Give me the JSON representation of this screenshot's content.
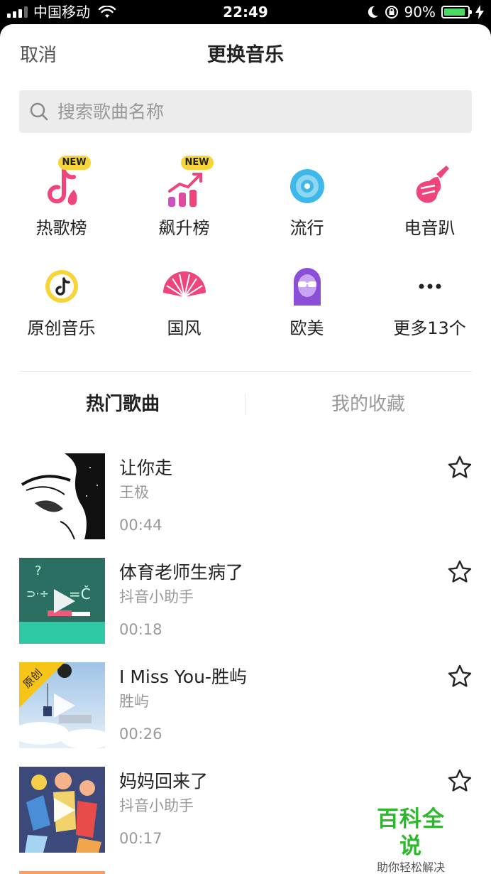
{
  "status_bar": {
    "carrier": "中国移动",
    "time": "22:49",
    "battery_percent": "90%",
    "battery_level": 0.9
  },
  "nav": {
    "cancel_label": "取消",
    "title": "更换音乐"
  },
  "search": {
    "placeholder": "搜索歌曲名称"
  },
  "categories": [
    {
      "label": "热歌榜",
      "icon": "hot-chart-icon",
      "badge": "NEW"
    },
    {
      "label": "飙升榜",
      "icon": "rising-chart-icon",
      "badge": "NEW"
    },
    {
      "label": "流行",
      "icon": "disc-icon"
    },
    {
      "label": "电音趴",
      "icon": "guitar-icon"
    },
    {
      "label": "原创音乐",
      "icon": "tiktok-note-icon"
    },
    {
      "label": "国风",
      "icon": "folding-fan-icon"
    },
    {
      "label": "欧美",
      "icon": "sunglasses-avatar-icon"
    },
    {
      "label": "更多13个",
      "icon": "more-dots-icon"
    }
  ],
  "tabs": [
    {
      "label": "热门歌曲",
      "active": true
    },
    {
      "label": "我的收藏",
      "active": false
    }
  ],
  "songs": [
    {
      "title": "让你走",
      "artist": "王极",
      "duration": "00:44",
      "cover": "eye-sketch-cover"
    },
    {
      "title": "体育老师生病了",
      "artist": "抖音小助手",
      "duration": "00:18",
      "cover": "chalkboard-cover"
    },
    {
      "title": "I Miss You-胜屿",
      "artist": "胜屿",
      "duration": "00:26",
      "cover": "sky-swing-cover",
      "badge": "原创"
    },
    {
      "title": "妈妈回来了",
      "artist": "抖音小助手",
      "duration": "00:17",
      "cover": "cartoon-dancers-cover"
    }
  ],
  "watermark": {
    "main": "百科全说",
    "sub": "助你轻松解决"
  },
  "colors": {
    "accent_pink": "#f0457a",
    "new_badge": "#f7d437",
    "watermark_green": "#2eb82e",
    "secondary_text": "#999999"
  }
}
